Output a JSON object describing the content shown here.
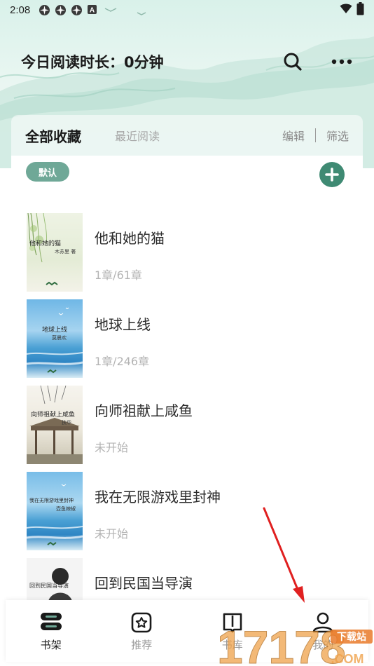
{
  "status_bar": {
    "time": "2:08",
    "left_icons": [
      "spinner-icon",
      "spinner-icon",
      "spinner-icon",
      "a-badge-icon"
    ],
    "right_icons": [
      "wifi-icon",
      "battery-icon"
    ]
  },
  "header": {
    "reading_time": "今日阅读时长：0分钟",
    "search_icon": "search-icon",
    "more_icon": "more-dots-icon"
  },
  "tabs": {
    "active": "全部收藏",
    "inactive": "最近阅读",
    "edit": "编辑",
    "filter": "筛选"
  },
  "list": {
    "sort_label": "默认",
    "add_icon": "plus-icon",
    "books": [
      {
        "title": "他和她的猫",
        "progress": "1章/61章",
        "cover_title": "他和她的猫",
        "cover_author": "木苏里 著",
        "cover_theme": "willow"
      },
      {
        "title": "地球上线",
        "progress": "1章/246章",
        "cover_title": "地球上线",
        "cover_author": "莫晨欢",
        "cover_theme": "sea"
      },
      {
        "title": "向师祖献上咸鱼",
        "progress": "未开始",
        "cover_title": "向师祖献上咸鱼",
        "cover_author": "扶华",
        "cover_theme": "pavilion"
      },
      {
        "title": "我在无限游戏里封神",
        "progress": "未开始",
        "cover_title": "我在无限游戏里封神",
        "cover_author": "壶鱼辣椒",
        "cover_theme": "sea"
      },
      {
        "title": "回到民国当导演",
        "progress": "",
        "cover_title": "回到民国当导演",
        "cover_author": "",
        "cover_theme": "portrait"
      }
    ]
  },
  "bottom_nav": [
    {
      "label": "书架",
      "icon": "bookshelf-icon",
      "active": true
    },
    {
      "label": "推荐",
      "icon": "recommend-star-icon",
      "active": false
    },
    {
      "label": "书库",
      "icon": "library-book-icon",
      "active": false
    },
    {
      "label": "我的",
      "icon": "profile-icon",
      "active": false
    }
  ],
  "watermark": {
    "text": "17178",
    "tag": "下载站",
    "domain": ".COM"
  },
  "colors": {
    "accent": "#3f8a73",
    "pill": "#6fa897",
    "arrow": "#e02020"
  }
}
